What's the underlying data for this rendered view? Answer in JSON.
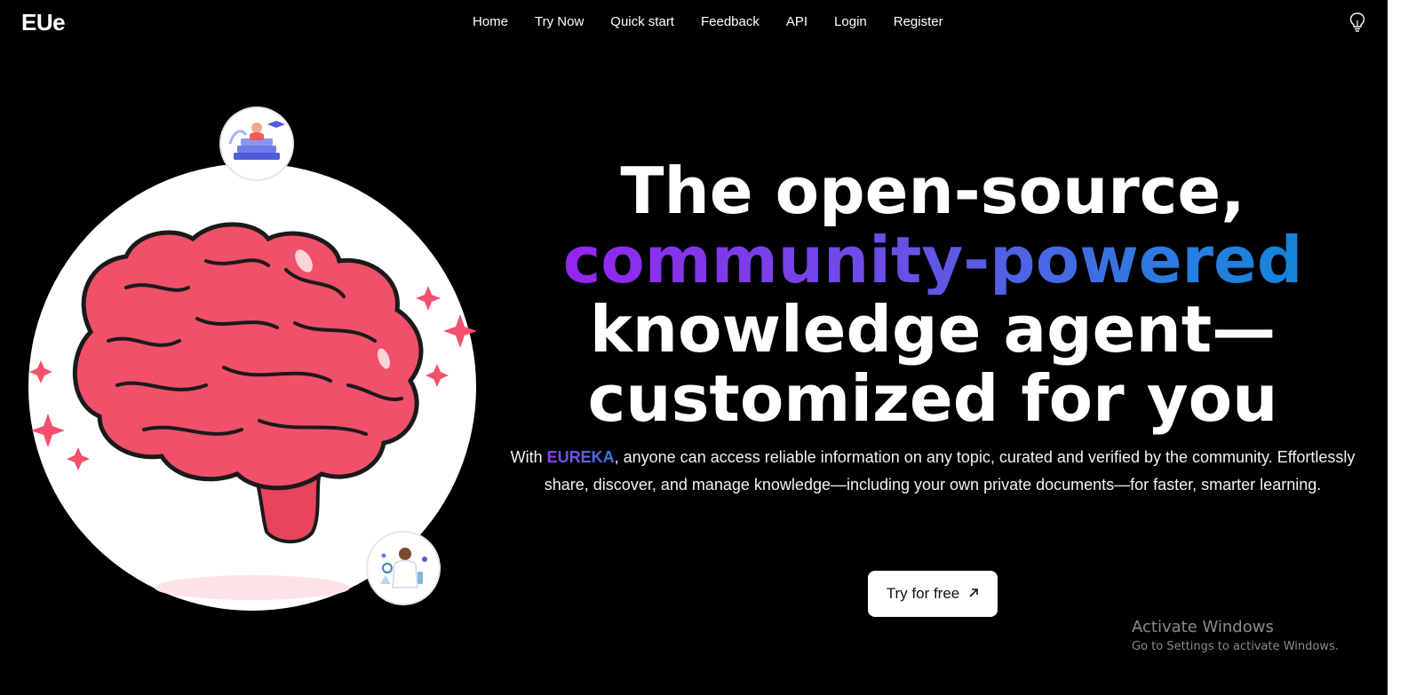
{
  "brand": {
    "logo": "EUe"
  },
  "nav": {
    "items": [
      "Home",
      "Try Now",
      "Quick start",
      "Feedback",
      "API",
      "Login",
      "Register"
    ],
    "theme_icon": "lightbulb-icon"
  },
  "hero": {
    "headline_line1": "The open-source,",
    "headline_line2": "community-powered",
    "headline_line3": "knowledge agent—",
    "headline_line4": "customized for you",
    "desc_prefix": "With ",
    "desc_brand": "EUREKA",
    "desc_rest": ", anyone can access reliable information on any topic, curated and verified by the community. Effortlessly share, discover, and manage knowledge—including your own private documents—for faster, smarter learning.",
    "cta_label": "Try for free",
    "cta_icon": "arrow-up-right-icon",
    "gradient_colors": [
      "#9b1ff0",
      "#0a86d6"
    ]
  },
  "os_watermark": {
    "title": "Activate Windows",
    "subtitle": "Go to Settings to activate Windows."
  },
  "colors": {
    "background": "#000000",
    "brain": "#f0506a",
    "text": "#ffffff"
  }
}
